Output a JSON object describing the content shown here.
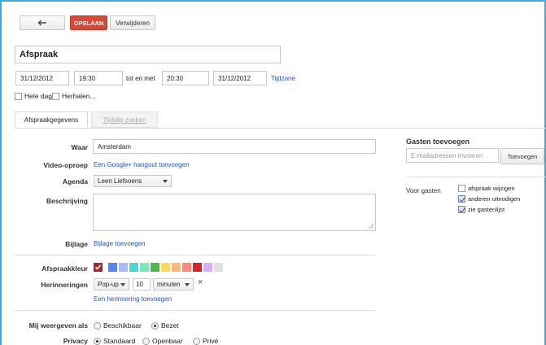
{
  "toolbar": {
    "back_icon": "back-arrow-icon",
    "save_label": "OPSLAAN",
    "delete_label": "Verwijderen"
  },
  "event": {
    "title": "Afspraak",
    "start_date": "31/12/2012",
    "start_time": "19:30",
    "range_label": "tot en met",
    "end_time": "20:30",
    "end_date": "31/12/2012",
    "timezone_link": "Tijdzone",
    "allday_label": "Hele dag",
    "repeat_label": "Herhalen..."
  },
  "tabs": [
    {
      "label": "Afspraakgegevens",
      "active": true
    },
    {
      "label": "Tijdstip zoeken",
      "active": false
    }
  ],
  "details": {
    "where_label": "Waar",
    "where_value": "Amsterdam",
    "video_label": "Video-oproep",
    "video_link": "Een Google+ hangout toevoegen",
    "agenda_label": "Agenda",
    "agenda_value": "Leen Liefsoens",
    "description_label": "Beschrijving",
    "attachment_label": "Bijlage",
    "attachment_link": "Bijlage toevoegen",
    "color_label": "Afspraakkleur",
    "colors": [
      "#a32929",
      "#5484ed",
      "#a4bdfc",
      "#46d6db",
      "#7ae7bf",
      "#51b749",
      "#fbd75b",
      "#ffb878",
      "#ff887c",
      "#dc2127",
      "#dbadff",
      "#e1e1e1"
    ],
    "reminders_label": "Herinneringen",
    "reminder_method": "Pop-up",
    "reminder_amount": "10",
    "reminder_unit": "minuten",
    "add_reminder_link": "Een herinnering toevoegen",
    "show_as_label": "Mij weergeven als",
    "show_as_options": [
      {
        "label": "Beschikbaar",
        "selected": false
      },
      {
        "label": "Bezet",
        "selected": true
      }
    ],
    "privacy_label": "Privacy",
    "privacy_options": [
      {
        "label": "Standaard",
        "selected": true
      },
      {
        "label": "Openbaar",
        "selected": false
      },
      {
        "label": "Privé",
        "selected": false
      }
    ]
  },
  "guests": {
    "title": "Gasten toevoegen",
    "email_placeholder": "E-mailadressen invoeren",
    "add_button": "Toevoegen",
    "for_guests_label": "Voor gasten",
    "permissions": [
      {
        "label": "afspraak wijzigen",
        "checked": false
      },
      {
        "label": "anderen uitnodigen",
        "checked": true
      },
      {
        "label": "zie gastenlijst",
        "checked": true
      }
    ]
  }
}
